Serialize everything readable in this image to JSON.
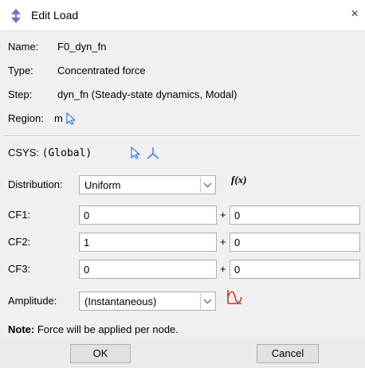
{
  "window": {
    "title": "Edit Load",
    "close_glyph": "×"
  },
  "info": {
    "name_label": "Name:",
    "name_value": "F0_dyn_fn",
    "type_label": "Type:",
    "type_value": "Concentrated force",
    "step_label": "Step:",
    "step_value": "dyn_fn (Steady-state dynamics, Modal)",
    "region_label": "Region:",
    "region_value": "m"
  },
  "csys": {
    "label": "CSYS:",
    "value": "(Global)"
  },
  "distribution": {
    "label": "Distribution:",
    "selected": "Uniform",
    "fx_label": "f(x)"
  },
  "cf": [
    {
      "label": "CF1:",
      "value": "0",
      "plus": "+",
      "fx_value": "0"
    },
    {
      "label": "CF2:",
      "value": "1",
      "plus": "+",
      "fx_value": "0"
    },
    {
      "label": "CF3:",
      "value": "0",
      "plus": "+",
      "fx_value": "0"
    }
  ],
  "amplitude": {
    "label": "Amplitude:",
    "selected": "(Instantaneous)"
  },
  "note": {
    "label": "Note:",
    "text": "Force will be applied per node."
  },
  "buttons": {
    "ok": "OK",
    "cancel": "Cancel"
  },
  "icons": {
    "title": "load-arrows-icon",
    "region_select": "select-arrow-icon",
    "csys_select": "select-arrow-icon",
    "csys_create": "axis-triad-icon",
    "amplitude_create": "amplitude-curve-icon"
  },
  "colors": {
    "pick_arrow": "#3c7fd8",
    "amplitude_icon": "#c0392b",
    "load_icon": "#6a5acd"
  }
}
